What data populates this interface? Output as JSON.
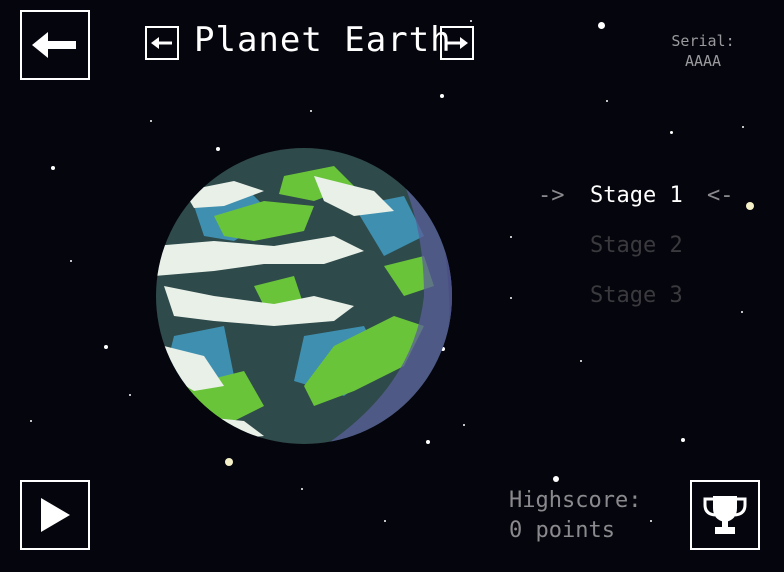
{
  "header": {
    "back_arrow": "←",
    "prev_arrow": "←",
    "planet_name": "Planet Earth",
    "next_arrow": "→",
    "serial_label": "Serial:",
    "serial_value": "AAAA"
  },
  "stages": {
    "left_marker": "->",
    "right_marker": "<-",
    "items": [
      {
        "label": "Stage 1",
        "selected": true
      },
      {
        "label": "Stage 2",
        "selected": false
      },
      {
        "label": "Stage 3",
        "selected": false
      }
    ]
  },
  "highscore": {
    "label": "Highscore:",
    "value": "0 points"
  },
  "controls": {
    "play_icon": "play-icon",
    "trophy_icon": "trophy-icon"
  },
  "colors": {
    "background": "#05050d",
    "ocean_dark": "#2e4a4a",
    "ocean_blue": "#3f8fb0",
    "land_green": "#6ac43a",
    "cloud_white": "#e8f0e8",
    "shadow_purple": "#5a5f9a",
    "stage_selected": "#ffffff",
    "stage_unselected": "#3a3a3e",
    "marker": "#8a8a8e"
  }
}
